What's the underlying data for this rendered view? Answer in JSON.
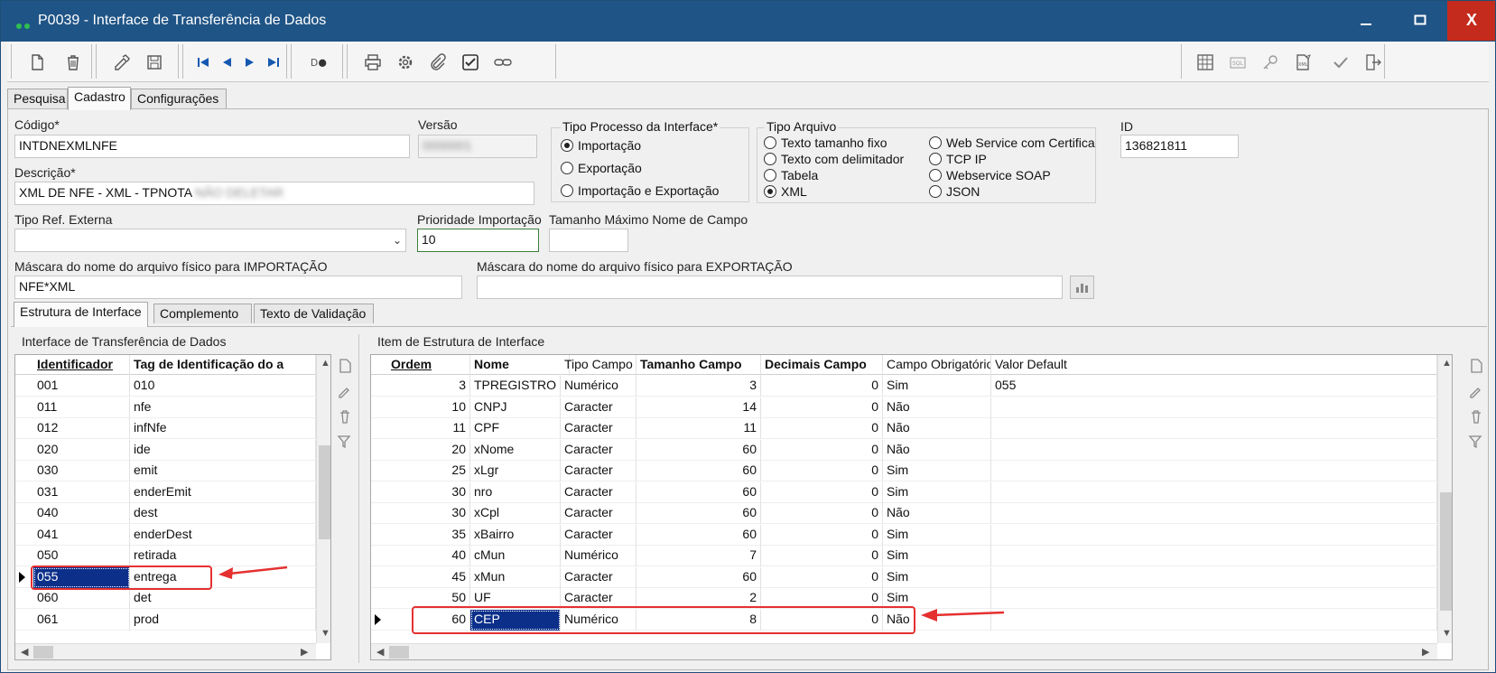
{
  "window": {
    "title": "P0039 - Interface de Transferência de Dados",
    "min": "—",
    "max": "☐",
    "close": "X"
  },
  "tabs_top": [
    "Pesquisa",
    "Cadastro",
    "Configurações"
  ],
  "form": {
    "codigo_label": "Código*",
    "codigo_value": "INTDNEXMLNFE",
    "versao_label": "Versão",
    "versao_value": "0000001",
    "descricao_label": "Descrição*",
    "descricao_value": "XML DE NFE - XML - TPNOTA",
    "descricao_blurred": "NÃO DELETAR",
    "tipo_ref_label": "Tipo Ref. Externa",
    "tipo_ref_value": "",
    "prioridade_label": "Prioridade Importação",
    "prioridade_value": "10",
    "tamanho_label": "Tamanho Máximo Nome de Campo",
    "tamanho_value": "",
    "mascara_imp_label": "Máscara do nome do arquivo físico para IMPORTAÇÃO",
    "mascara_imp_value": "NFE*XML",
    "mascara_exp_label": "Máscara do nome do arquivo físico para EXPORTAÇÃO",
    "mascara_exp_value": "",
    "id_label": "ID",
    "id_value": "136821811"
  },
  "tipo_processo": {
    "title": "Tipo Processo da Interface*",
    "options": [
      "Importação",
      "Exportação",
      "Importação e Exportação"
    ],
    "selected": 0
  },
  "tipo_arquivo": {
    "title": "Tipo Arquivo",
    "col1": [
      "Texto tamanho fixo",
      "Texto com delimitador",
      "Tabela",
      "XML"
    ],
    "col2": [
      "Web Service com Certifica",
      "TCP IP",
      "Webservice SOAP",
      "JSON"
    ],
    "selected": "XML"
  },
  "tabs_mid": [
    "Estrutura de Interface",
    "Complemento",
    "Texto de Validação"
  ],
  "left_grid": {
    "title": "Interface de Transferência de Dados",
    "headers": [
      "Identificador",
      "Tag de Identificação do a"
    ],
    "rows": [
      [
        "001",
        "010"
      ],
      [
        "011",
        "nfe"
      ],
      [
        "012",
        "infNfe"
      ],
      [
        "020",
        "ide"
      ],
      [
        "030",
        "emit"
      ],
      [
        "031",
        "enderEmit"
      ],
      [
        "040",
        "dest"
      ],
      [
        "041",
        "enderDest"
      ],
      [
        "050",
        "retirada"
      ],
      [
        "055",
        "entrega"
      ],
      [
        "060",
        "det"
      ],
      [
        "061",
        "prod"
      ]
    ],
    "selected_row": 9
  },
  "right_grid": {
    "title": "Item de Estrutura de Interface",
    "headers": [
      "Ordem",
      "Nome",
      "Tipo Campo",
      "Tamanho Campo",
      "Decimais Campo",
      "Campo Obrigatório",
      "Valor Default"
    ],
    "rows": [
      [
        "3",
        "TPREGISTRO",
        "Numérico",
        "3",
        "0",
        "Sim",
        "055"
      ],
      [
        "10",
        "CNPJ",
        "Caracter",
        "14",
        "0",
        "Não",
        ""
      ],
      [
        "11",
        "CPF",
        "Caracter",
        "11",
        "0",
        "Não",
        ""
      ],
      [
        "20",
        "xNome",
        "Caracter",
        "60",
        "0",
        "Não",
        ""
      ],
      [
        "25",
        "xLgr",
        "Caracter",
        "60",
        "0",
        "Sim",
        ""
      ],
      [
        "30",
        "nro",
        "Caracter",
        "60",
        "0",
        "Sim",
        ""
      ],
      [
        "30",
        "xCpl",
        "Caracter",
        "60",
        "0",
        "Não",
        ""
      ],
      [
        "35",
        "xBairro",
        "Caracter",
        "60",
        "0",
        "Sim",
        ""
      ],
      [
        "40",
        "cMun",
        "Numérico",
        "7",
        "0",
        "Sim",
        ""
      ],
      [
        "45",
        "xMun",
        "Caracter",
        "60",
        "0",
        "Sim",
        ""
      ],
      [
        "50",
        "UF",
        "Caracter",
        "2",
        "0",
        "Sim",
        ""
      ],
      [
        "60",
        "CEP",
        "Numérico",
        "8",
        "0",
        "Não",
        ""
      ]
    ],
    "selected_row": 11
  },
  "colors": {
    "titlebar": "#1f5486",
    "close": "#c42b1c",
    "selection": "#0c2f8a",
    "annotation": "#e53030"
  }
}
